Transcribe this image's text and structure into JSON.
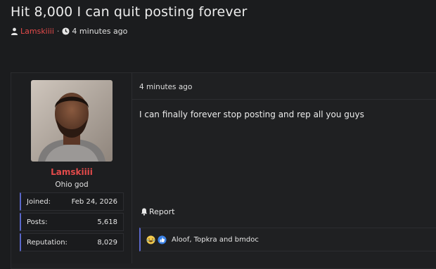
{
  "thread": {
    "title": "Hit 8,000 I can quit posting forever",
    "author": "Lamskiiii",
    "separator": "·",
    "time": "4 minutes ago"
  },
  "post": {
    "user": {
      "name": "Lamskiiii",
      "title": "Ohio god",
      "stats": [
        {
          "label": "Joined:",
          "value": "Feb 24, 2026"
        },
        {
          "label": "Posts:",
          "value": "5,618"
        },
        {
          "label": "Reputation:",
          "value": "8,029"
        }
      ]
    },
    "time": "4 minutes ago",
    "text": "I can finally forever stop posting and rep all you guys",
    "report_label": "Report",
    "reactions": {
      "icons": [
        "laughing-emoji-icon",
        "like-thumb-icon"
      ],
      "users": "Aloof, Topkra and bmdoc"
    }
  },
  "colors": {
    "background": "#1b1c1e",
    "username": "#e34a4a",
    "accent": "#5a67c8"
  }
}
